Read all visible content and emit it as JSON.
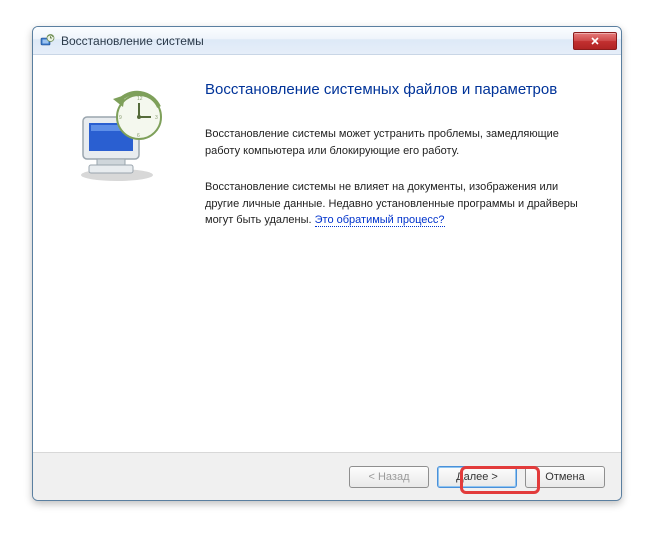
{
  "window": {
    "title": "Восстановление системы"
  },
  "content": {
    "heading": "Восстановление системных файлов и параметров",
    "para1": "Восстановление системы может устранить проблемы, замедляющие работу компьютера или блокирующие его работу.",
    "para2_prefix": "Восстановление системы не влияет на документы, изображения или другие личные данные. Недавно установленные программы и драйверы могут быть удалены. ",
    "link": "Это обратимый процесс?"
  },
  "buttons": {
    "back": "< Назад",
    "next": "Далее >",
    "cancel": "Отмена"
  },
  "icons": {
    "app": "system-restore-icon",
    "close": "close-icon",
    "restore": "restore-image-icon"
  }
}
